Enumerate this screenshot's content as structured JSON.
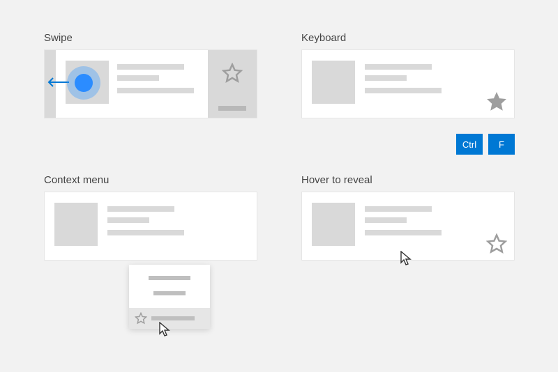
{
  "sections": {
    "swipe": {
      "title": "Swipe"
    },
    "keyboard": {
      "title": "Keyboard"
    },
    "context_menu": {
      "title": "Context menu"
    },
    "hover": {
      "title": "Hover to reveal"
    }
  },
  "keys": {
    "ctrl": "Ctrl",
    "f": "F"
  },
  "icons": {
    "star_outline": "star-outline-icon",
    "star_filled": "star-filled-icon",
    "arrow_left": "arrow-left-icon",
    "cursor": "cursor-icon",
    "touch": "touch-point-icon"
  }
}
